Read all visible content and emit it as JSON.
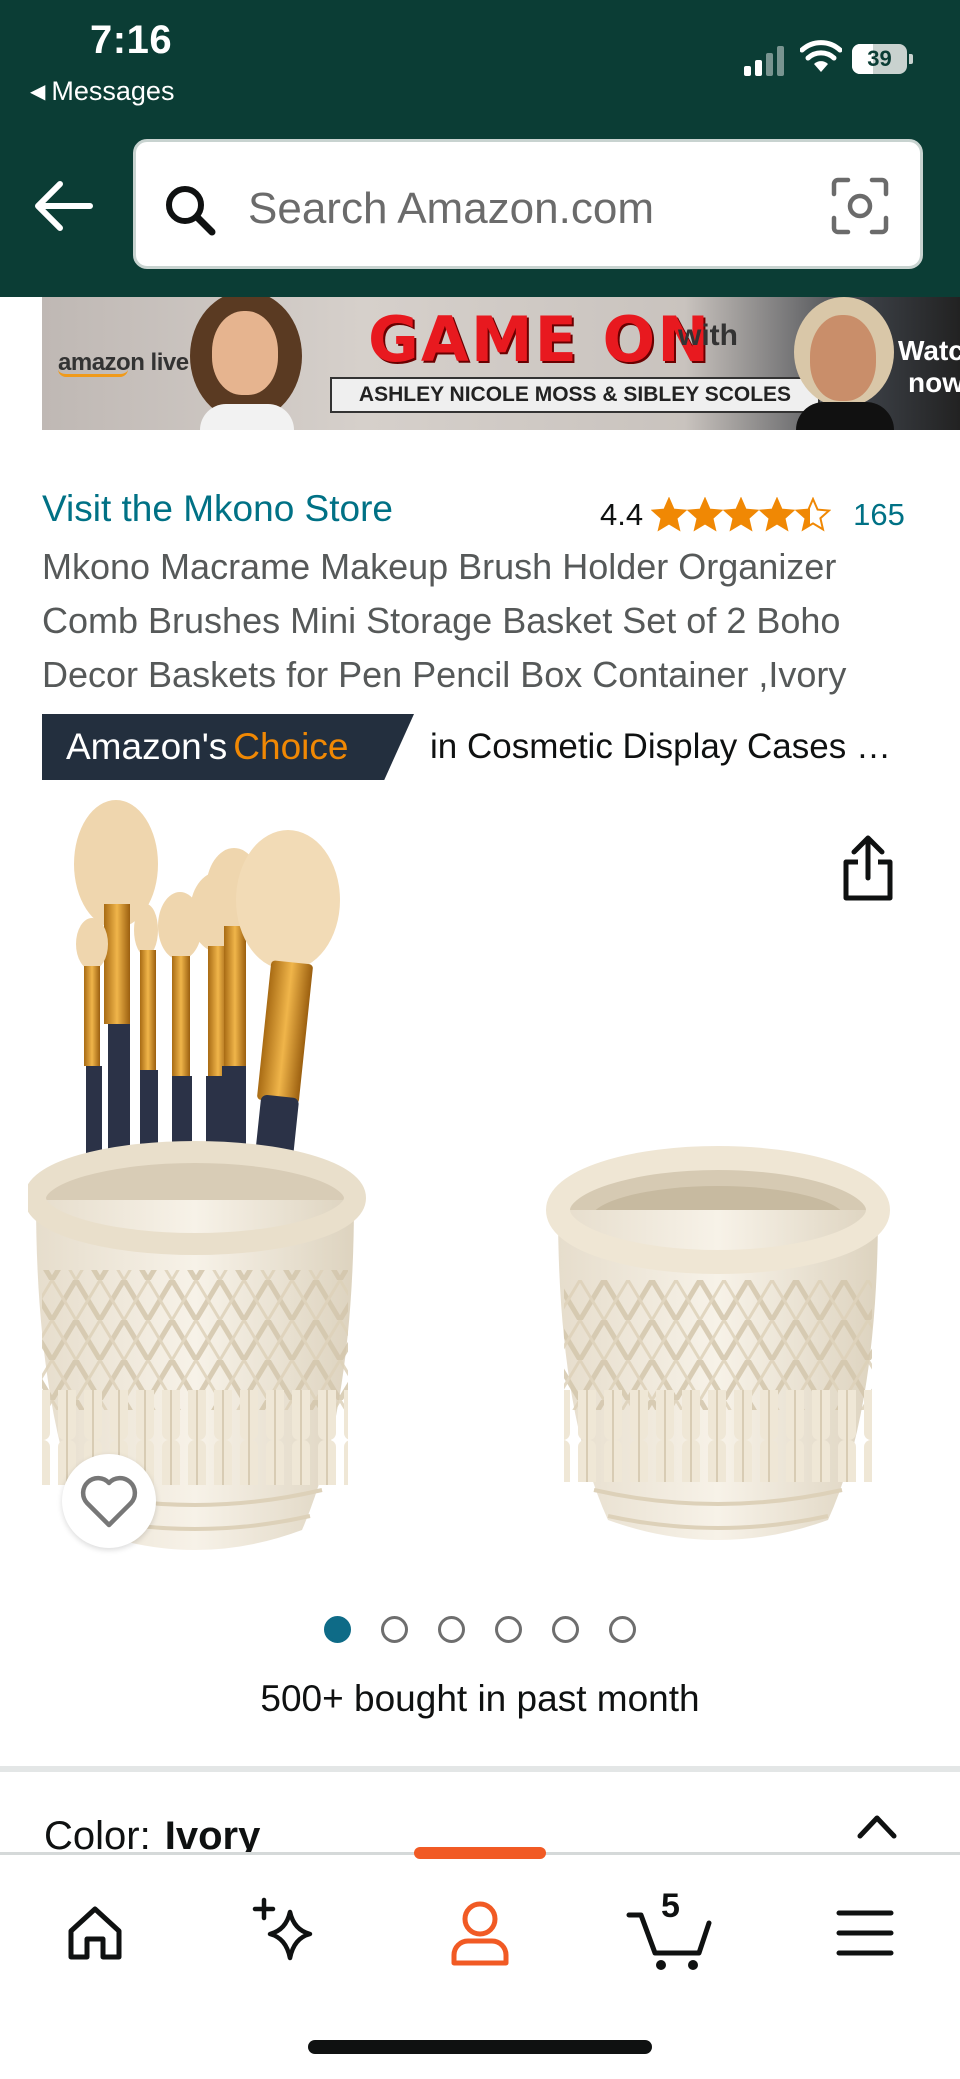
{
  "status_bar": {
    "time": "7:16",
    "back_app": "Messages",
    "battery": "39",
    "battery_level": 0.39
  },
  "search": {
    "placeholder": "Search Amazon.com"
  },
  "banner": {
    "logo": "amazon live",
    "headline": "GAME ON",
    "with": "with",
    "names": "ASHLEY NICOLE MOSS & SIBLEY SCOLES",
    "watch_line1": "Watc",
    "watch_line2": "now"
  },
  "product": {
    "store_link": "Visit the Mkono Store",
    "rating_value": "4.4",
    "rating": 4.4,
    "rating_count": "165",
    "title": "Mkono Macrame Makeup Brush Holder Organizer Comb Brushes Mini Storage Basket Set of 2 Boho Decor Baskets for Pen Pencil Box Container ,Ivory",
    "badge_prefix": "Amazon's",
    "badge_accent": "Choice",
    "badge_category": "in Cosmetic Display Cases …",
    "bought": "500+ bought in past month",
    "color_label": "Color:",
    "color_value": "Ivory"
  },
  "gallery": {
    "image_count": 6,
    "active_index": 0
  },
  "bottom_nav": {
    "items": [
      "home",
      "rufus",
      "account",
      "cart",
      "menu"
    ],
    "active": "account",
    "cart_count": "5"
  },
  "colors": {
    "header_bg": "#0b3d35",
    "link": "#007185",
    "star": "#f08804",
    "badge_bg": "#232f3e",
    "active_nav": "#f15a24",
    "dot_active": "#0e6b87"
  }
}
